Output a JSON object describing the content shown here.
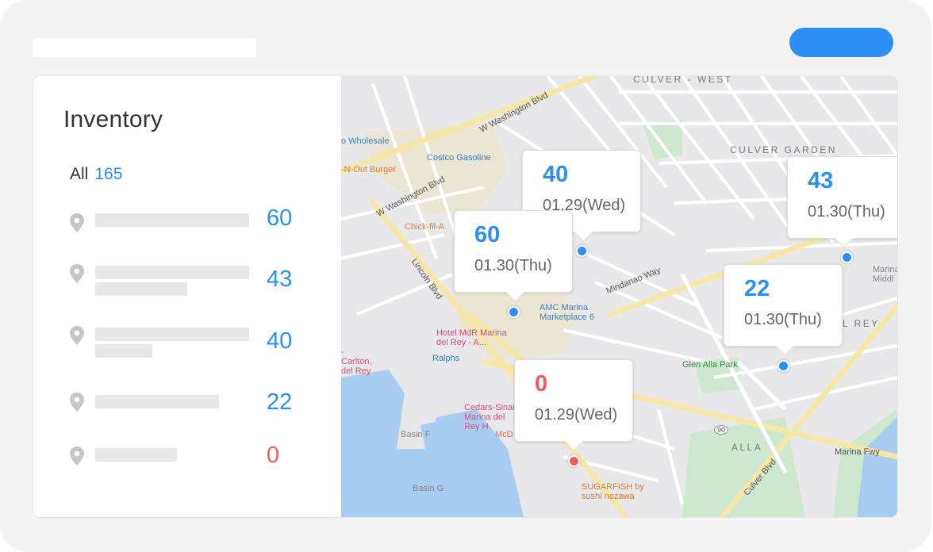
{
  "inventory": {
    "title": "Inventory",
    "all_label": "All",
    "all_count": "165",
    "items": [
      {
        "value": "60",
        "status": "ok"
      },
      {
        "value": "43",
        "status": "ok"
      },
      {
        "value": "40",
        "status": "ok"
      },
      {
        "value": "22",
        "status": "ok"
      },
      {
        "value": "0",
        "status": "empty"
      }
    ]
  },
  "map": {
    "callouts": [
      {
        "value": "40",
        "date": "01.29(Wed)"
      },
      {
        "value": "60",
        "date": "01.30(Thu)"
      },
      {
        "value": "43",
        "date": "01.30(Thu)"
      },
      {
        "value": "22",
        "date": "01.30(Thu)"
      },
      {
        "value": "0",
        "date": "01.29(Wed)"
      }
    ],
    "labels": {
      "culver_west": "CULVER - WEST",
      "culver_garden": "CULVER GARDEN",
      "l_rey": "L REY",
      "alla": "ALLA",
      "wholesale": "o Wholesale",
      "costco_gas": "Costco Gasoline",
      "in_n_out": "-N-Out Burger",
      "chick_fil_a": "Chick-fil-A",
      "amc": "AMC Marina Marketplace 6",
      "hotel": "Hotel MdR Marina del Rey - A...",
      "ralphs": "Ralphs",
      "cedars": "Cedars-Sinai Marina del Rey H",
      "sugarfish": "SUGARFISH by sushi nozawa",
      "glen_alla": "Glen Alla Park",
      "marina_fwy": "Marina Fwy",
      "culver_blvd": "Culver Blvd",
      "lincoln_blvd": "Lincoln Blvd",
      "mindanao": "Mindanao Way",
      "w_washington": "W Washington Blvd",
      "w_washington2": "W Washington Blvd",
      "basin_f": "Basin F",
      "basin_g": "Basin G",
      "marina_mid": "Marina Middl",
      "carlton": "-Carlton, del Rey",
      "mcd": "McD",
      "route_90": "90"
    }
  },
  "colors": {
    "accent": "#2b8ff5",
    "alert": "#f45b5b",
    "frame": "#f3f3f3"
  }
}
